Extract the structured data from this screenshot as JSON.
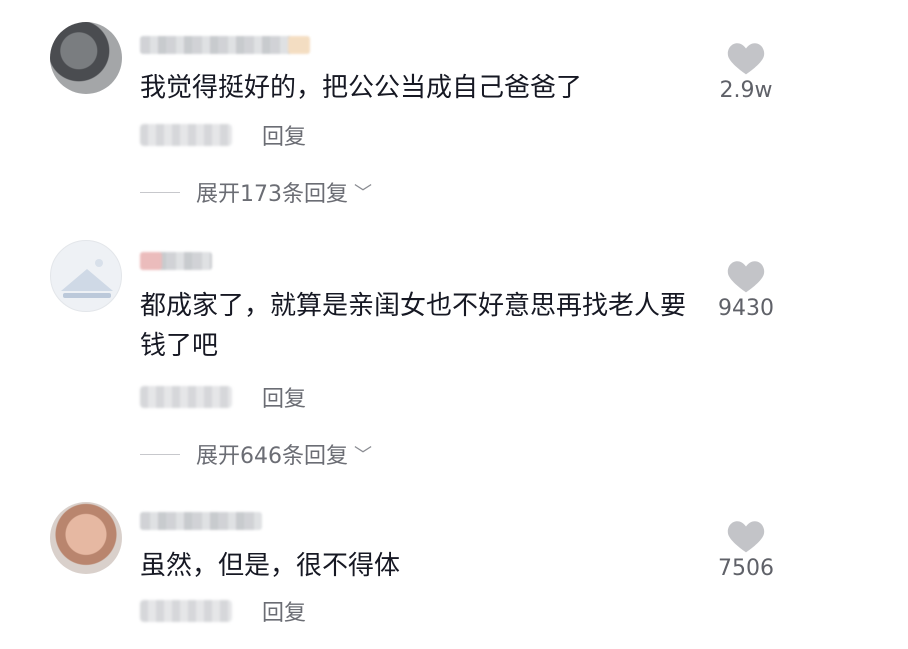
{
  "comments": [
    {
      "text": "我觉得挺好的，把公公当成自己爸爸了",
      "reply_label": "回复",
      "expand_label": "展开173条回复",
      "likes": "2.9w"
    },
    {
      "text": "都成家了，就算是亲闺女也不好意思再找老人要钱了吧",
      "reply_label": "回复",
      "expand_label": "展开646条回复",
      "likes": "9430"
    },
    {
      "text": "虽然，但是，很不得体",
      "reply_label": "回复",
      "likes": "7506"
    }
  ],
  "icons": {
    "like": "heart-icon",
    "expand": "chevron-down-icon"
  },
  "colors": {
    "text": "#161823",
    "secondary": "#6b6d74",
    "heart": "#c3c4c8"
  }
}
